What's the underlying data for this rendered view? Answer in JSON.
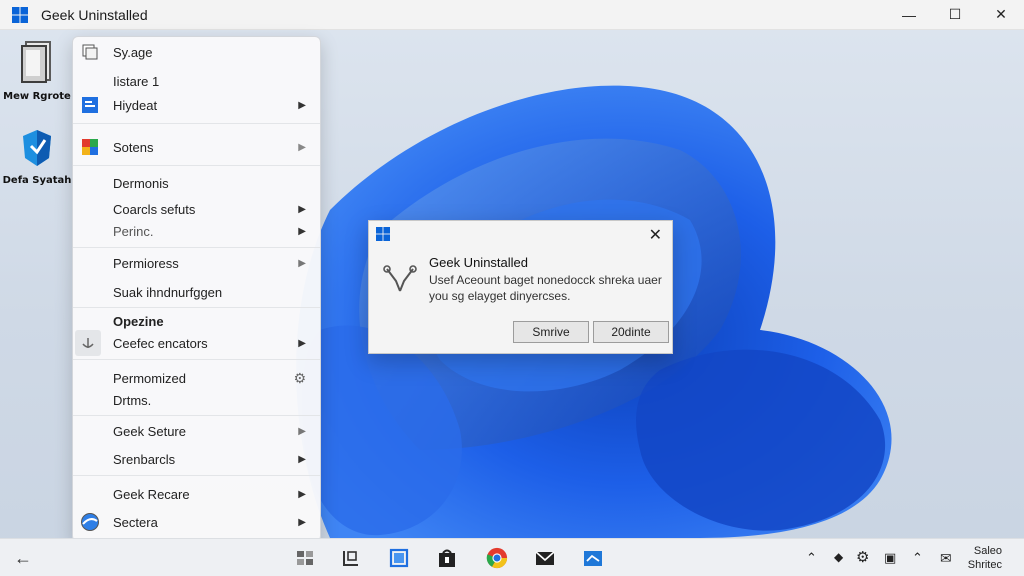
{
  "window": {
    "title": "Geek Uninstalled",
    "minimize": "—",
    "maximize": "☐",
    "close": "✕"
  },
  "desktop": {
    "icons": [
      {
        "label": "Mew Rgrote",
        "icon": "document-icon"
      },
      {
        "label": "Defa Syatah",
        "icon": "shield-app-icon"
      }
    ]
  },
  "menu": {
    "items": [
      {
        "label": "Sy.age",
        "icon": "copy-icon",
        "chevron": false
      },
      {
        "label": "Iistare 1",
        "icon": "",
        "chevron": false
      },
      {
        "label": "Hiydeat",
        "icon": "blue-app-icon",
        "chevron": true
      },
      {
        "label": "Sotens",
        "icon": "color-app-icon",
        "chevron": true
      },
      {
        "label": "Dermonis",
        "icon": "",
        "chevron": false
      },
      {
        "label": "Coarcls sefuts",
        "icon": "",
        "chevron": true
      },
      {
        "label": "Perinc.",
        "icon": "",
        "chevron": true
      },
      {
        "label": "Permioress",
        "icon": "",
        "chevron": true
      },
      {
        "label": "Suak ihndnurfggen",
        "icon": "",
        "chevron": false
      },
      {
        "label": "Opezine",
        "icon": "",
        "chevron": false
      },
      {
        "label": "Ceefec encators",
        "icon": "anchor-icon",
        "chevron": true
      },
      {
        "label": "Permomized",
        "icon": "",
        "chevron": false
      },
      {
        "label": "Drtms.",
        "icon": "",
        "chevron": false
      },
      {
        "label": "Geek Seture",
        "icon": "",
        "chevron": true
      },
      {
        "label": "Srenbarcls",
        "icon": "",
        "chevron": true
      },
      {
        "label": "Geek Recare",
        "icon": "",
        "chevron": true
      },
      {
        "label": "Sectera",
        "icon": "globe-icon",
        "chevron": true
      }
    ]
  },
  "dialog": {
    "title": "Geek Uninstalled",
    "message": "Usef Aceount baget nonedocck shreka uaer you sg elayget dinyercses.",
    "button_1": "Smrive",
    "button_2": "20dinte",
    "close": "✕"
  },
  "taskbar": {
    "back": "←",
    "clock_line1": "Saleo",
    "clock_line2": "Shritec"
  },
  "colors": {
    "accent": "#0a64d8",
    "wallpaper_blue": "#1e5fe6"
  }
}
